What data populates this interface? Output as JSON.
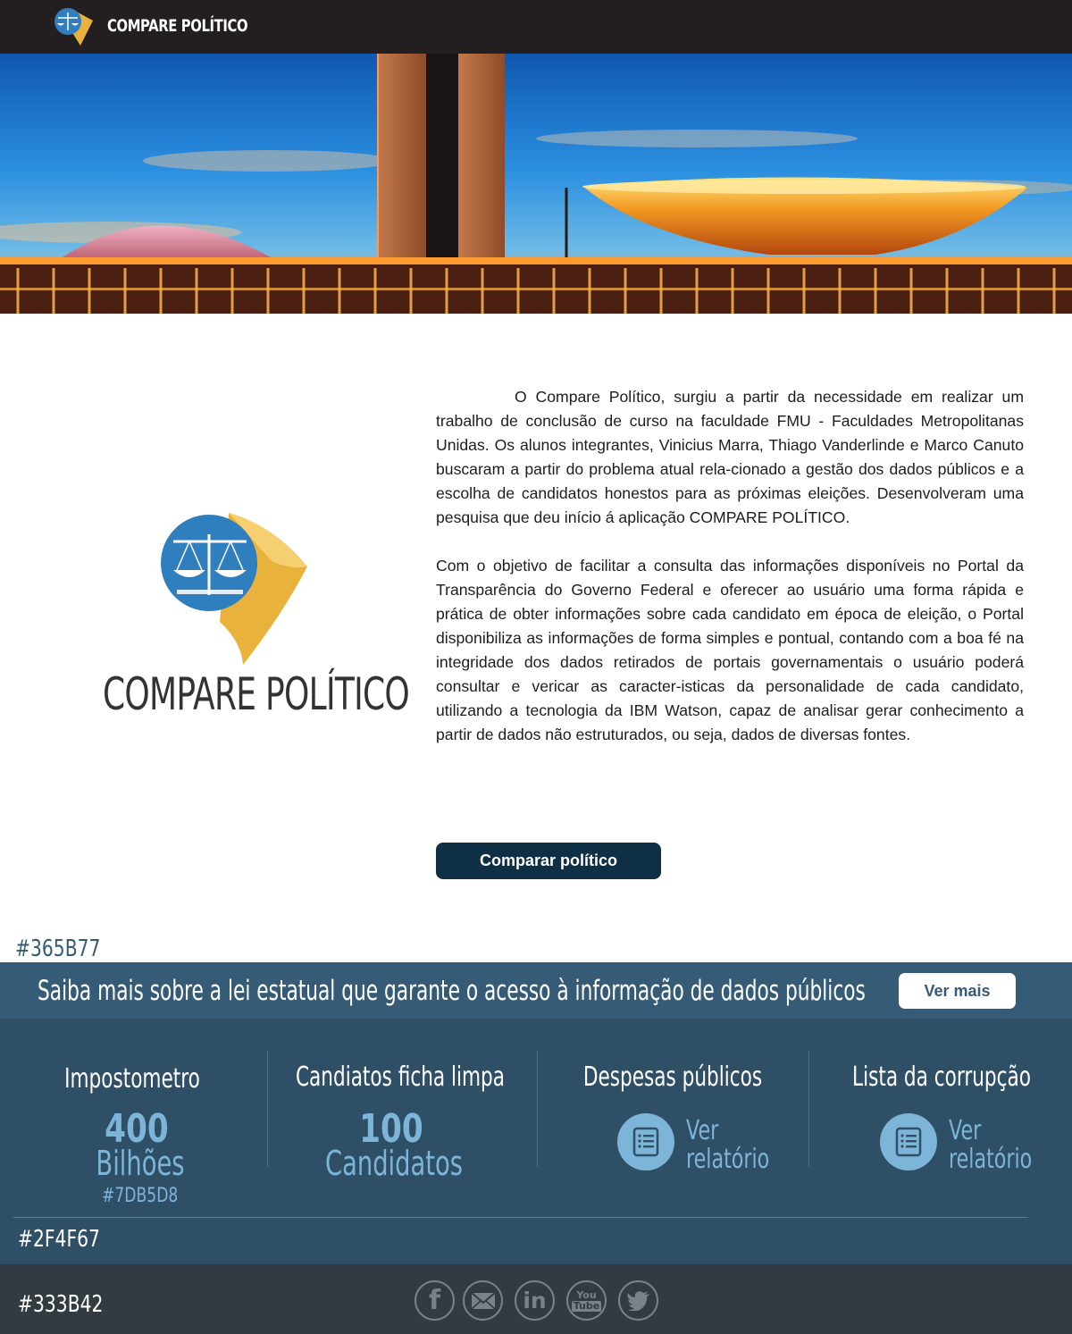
{
  "header": {
    "brand": "COMPARE POLÍTICO"
  },
  "intro": {
    "logo_text": "COMPARE POLÍTICO",
    "paragraph1": "O Compare Político, surgiu a partir da necessidade em realizar um trabalho de conclusão de curso na faculdade FMU - Faculdades Metropolitanas Unidas. Os alunos integrantes, Vinicius Marra, Thiago Vanderlinde e Marco Canuto buscaram a partir do problema atual rela-cionado a gestão dos dados públicos e a escolha de candidatos honestos para as próximas eleições. Desenvolveram uma pesquisa que deu início á aplicação COMPARE POLÍTICO.",
    "paragraph2": "Com o objetivo de facilitar a consulta das informações disponíveis no Portal da Transparência do Governo Federal e oferecer ao usuário uma forma rápida e prática de obter informações sobre cada candidato em época de eleição, o Portal disponibiliza as informações de forma simples e pontual, contando com a boa fé na integridade dos dados retirados de portais governamentais o usuário poderá consultar e vericar as caracter-isticas da personalidade de cada candidato, utilizando a tecnologia da IBM Watson, capaz de analisar gerar conhecimento a partir de dados não estruturados, ou seja, dados de diversas fontes.",
    "cta_label": "Comparar político"
  },
  "annotations": {
    "banner_color": "#365B77",
    "accent_color": "#7DB5D8",
    "stats_color": "#2F4F67",
    "footer_color": "#333B42"
  },
  "banner": {
    "text": "Saiba mais sobre a lei estatual que garante o acesso à informação de dados públicos",
    "button_label": "Ver mais"
  },
  "stats": [
    {
      "title": "Impostometro",
      "value": "400",
      "unit": "Bilhões"
    },
    {
      "title": "Candiatos ficha limpa",
      "value": "100",
      "unit": "Candidatos"
    },
    {
      "title": "Despesas públicos",
      "link_line1": "Ver",
      "link_line2": "relatório",
      "icon": "document-icon"
    },
    {
      "title": "Lista da corrupção",
      "link_line1": "Ver",
      "link_line2": "relatório",
      "icon": "document-icon"
    }
  ],
  "footer": {
    "social": [
      "facebook-icon",
      "email-icon",
      "linkedin-icon",
      "youtube-icon",
      "twitter-icon"
    ],
    "youtube_top": "You",
    "youtube_bottom": "Tube",
    "linkedin_text": "in",
    "facebook_text": "f"
  },
  "colors": {
    "topbar": "#231f20",
    "banner": "#365b77",
    "stats": "#2f4f67",
    "accent": "#7db5d8",
    "footer": "#333b42",
    "button_dark": "#0f2f45"
  }
}
